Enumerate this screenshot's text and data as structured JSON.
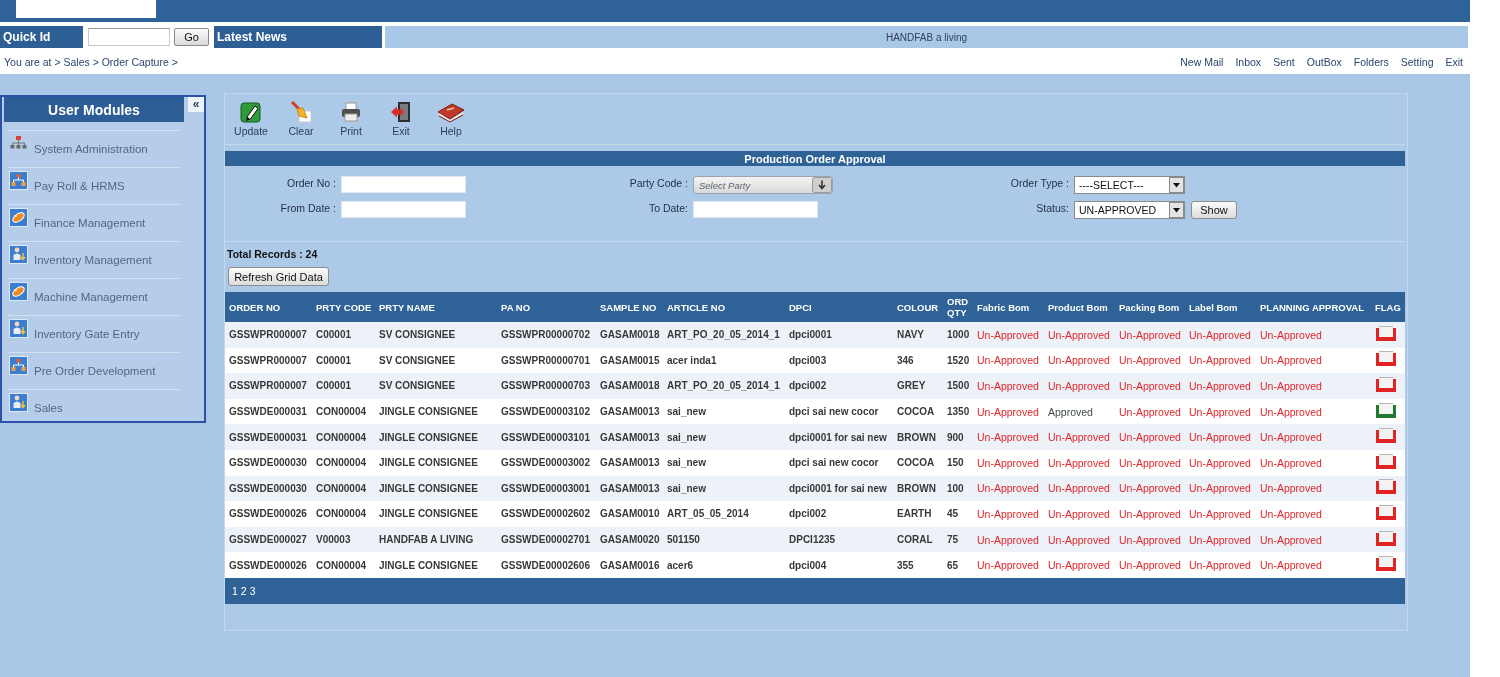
{
  "header": {
    "quick_id": {
      "label": "Quick Id",
      "button": "Go"
    },
    "news": {
      "label": "Latest News",
      "ticker": "HANDFAB a living"
    }
  },
  "breadcrumb": "You are at > Sales > Order Capture >",
  "top_links": [
    "New Mail",
    "Inbox",
    "Sent",
    "OutBox",
    "Folders",
    "Setting",
    "Exit"
  ],
  "sidebar": {
    "title": "User Modules",
    "collapse_button": "«",
    "items": [
      {
        "label": "System Administration",
        "kind": "hierarchy"
      },
      {
        "label": "Pay Roll & HRMS",
        "kind": "team"
      },
      {
        "label": "Finance Management",
        "kind": "pill"
      },
      {
        "label": "Inventory Management",
        "kind": "person"
      },
      {
        "label": "Machine Management",
        "kind": "pill"
      },
      {
        "label": "Inventory Gate Entry",
        "kind": "person"
      },
      {
        "label": "Pre Order Development",
        "kind": "team"
      },
      {
        "label": "Sales",
        "kind": "person"
      }
    ]
  },
  "toolbar": [
    {
      "label": "Update",
      "kind": "update"
    },
    {
      "label": "Clear",
      "kind": "clear"
    },
    {
      "label": "Print",
      "kind": "print"
    },
    {
      "label": "Exit",
      "kind": "exit"
    },
    {
      "label": "Help",
      "kind": "help"
    }
  ],
  "form": {
    "title": "Production Order Approval",
    "fields": [
      {
        "label": "Order No :",
        "kind": "text"
      },
      {
        "label": "Party Code :",
        "kind": "combo",
        "placeholder": "Select Party"
      },
      {
        "label": "Order Type :",
        "kind": "select",
        "value": "----SELECT---"
      },
      {
        "label": "From Date :",
        "kind": "date"
      },
      {
        "label": "To Date:",
        "kind": "date"
      },
      {
        "label": "Status:",
        "kind": "select",
        "value": "UN-APPROVED",
        "button": "Show"
      }
    ]
  },
  "total_records": "Total Records : 24",
  "refresh_button": "Refresh Grid Data",
  "table": {
    "columns": [
      "ORDER NO",
      "PRTY CODE",
      "PRTY NAME",
      "PA NO",
      "SAMPLE NO",
      "ARTICLE NO",
      "DPCI",
      "COLOUR",
      "ORD QTY",
      "Fabric Bom",
      "Product Bom",
      "Packing Bom",
      "Label Bom",
      "PLANNING APPROVAL",
      "FLAG"
    ],
    "rows": [
      {
        "cells": [
          "GSSWPR000007",
          "C00001",
          "SV CONSIGNEE",
          "GSSWPR00000702",
          "GASAM0018",
          "ART_PO_20_05_2014_1",
          "dpci0001",
          "NAVY",
          "1000"
        ],
        "approvals": [
          {
            "text": "Un-Approved",
            "approved": false
          },
          {
            "text": "Un-Approved",
            "approved": false
          },
          {
            "text": "Un-Approved",
            "approved": false
          },
          {
            "text": "Un-Approved",
            "approved": false
          },
          {
            "text": "Un-Approved",
            "approved": false
          }
        ],
        "flag": {
          "color": "#e02424"
        }
      },
      {
        "cells": [
          "GSSWPR000007",
          "C00001",
          "SV CONSIGNEE",
          "GSSWPR00000701",
          "GASAM0015",
          "acer inda1",
          "dpci003",
          "346",
          "1520"
        ],
        "approvals": [
          {
            "text": "Un-Approved",
            "approved": false
          },
          {
            "text": "Un-Approved",
            "approved": false
          },
          {
            "text": "Un-Approved",
            "approved": false
          },
          {
            "text": "Un-Approved",
            "approved": false
          },
          {
            "text": "Un-Approved",
            "approved": false
          }
        ],
        "flag": {
          "color": "#e02424"
        }
      },
      {
        "cells": [
          "GSSWPR000007",
          "C00001",
          "SV CONSIGNEE",
          "GSSWPR00000703",
          "GASAM0018",
          "ART_PO_20_05_2014_1",
          "dpci002",
          "GREY",
          "1500"
        ],
        "approvals": [
          {
            "text": "Un-Approved",
            "approved": false
          },
          {
            "text": "Un-Approved",
            "approved": false
          },
          {
            "text": "Un-Approved",
            "approved": false
          },
          {
            "text": "Un-Approved",
            "approved": false
          },
          {
            "text": "Un-Approved",
            "approved": false
          }
        ],
        "flag": {
          "color": "#e02424"
        }
      },
      {
        "cells": [
          "GSSWDE000031",
          "CON00004",
          "JINGLE CONSIGNEE",
          "GSSWDE00003102",
          "GASAM0013",
          "sai_new",
          "dpci sai new cocor",
          "COCOA",
          "1350"
        ],
        "approvals": [
          {
            "text": "Un-Approved",
            "approved": false
          },
          {
            "text": "Approved",
            "approved": true
          },
          {
            "text": "Un-Approved",
            "approved": false
          },
          {
            "text": "Un-Approved",
            "approved": false
          },
          {
            "text": "Un-Approved",
            "approved": false
          }
        ],
        "flag": {
          "color": "#1f7a30"
        }
      },
      {
        "cells": [
          "GSSWDE000031",
          "CON00004",
          "JINGLE CONSIGNEE",
          "GSSWDE00003101",
          "GASAM0013",
          "sai_new",
          "dpci0001 for sai new",
          "BROWN",
          "900"
        ],
        "approvals": [
          {
            "text": "Un-Approved",
            "approved": false
          },
          {
            "text": "Un-Approved",
            "approved": false
          },
          {
            "text": "Un-Approved",
            "approved": false
          },
          {
            "text": "Un-Approved",
            "approved": false
          },
          {
            "text": "Un-Approved",
            "approved": false
          }
        ],
        "flag": {
          "color": "#e02424"
        }
      },
      {
        "cells": [
          "GSSWDE000030",
          "CON00004",
          "JINGLE CONSIGNEE",
          "GSSWDE00003002",
          "GASAM0013",
          "sai_new",
          "dpci sai new cocor",
          "COCOA",
          "150"
        ],
        "approvals": [
          {
            "text": "Un-Approved",
            "approved": false
          },
          {
            "text": "Un-Approved",
            "approved": false
          },
          {
            "text": "Un-Approved",
            "approved": false
          },
          {
            "text": "Un-Approved",
            "approved": false
          },
          {
            "text": "Un-Approved",
            "approved": false
          }
        ],
        "flag": {
          "color": "#e02424"
        }
      },
      {
        "cells": [
          "GSSWDE000030",
          "CON00004",
          "JINGLE CONSIGNEE",
          "GSSWDE00003001",
          "GASAM0013",
          "sai_new",
          "dpci0001 for sai new",
          "BROWN",
          "100"
        ],
        "approvals": [
          {
            "text": "Un-Approved",
            "approved": false
          },
          {
            "text": "Un-Approved",
            "approved": false
          },
          {
            "text": "Un-Approved",
            "approved": false
          },
          {
            "text": "Un-Approved",
            "approved": false
          },
          {
            "text": "Un-Approved",
            "approved": false
          }
        ],
        "flag": {
          "color": "#e02424"
        }
      },
      {
        "cells": [
          "GSSWDE000026",
          "CON00004",
          "JINGLE CONSIGNEE",
          "GSSWDE00002602",
          "GASAM0010",
          "ART_05_05_2014",
          "dpci002",
          "EARTH",
          "45"
        ],
        "approvals": [
          {
            "text": "Un-Approved",
            "approved": false
          },
          {
            "text": "Un-Approved",
            "approved": false
          },
          {
            "text": "Un-Approved",
            "approved": false
          },
          {
            "text": "Un-Approved",
            "approved": false
          },
          {
            "text": "Un-Approved",
            "approved": false
          }
        ],
        "flag": {
          "color": "#e02424"
        }
      },
      {
        "cells": [
          "GSSWDE000027",
          "V00003",
          "HANDFAB A LIVING",
          "GSSWDE00002701",
          "GASAM0020",
          "501150",
          "DPCI1235",
          "CORAL",
          "75"
        ],
        "approvals": [
          {
            "text": "Un-Approved",
            "approved": false
          },
          {
            "text": "Un-Approved",
            "approved": false
          },
          {
            "text": "Un-Approved",
            "approved": false
          },
          {
            "text": "Un-Approved",
            "approved": false
          },
          {
            "text": "Un-Approved",
            "approved": false
          }
        ],
        "flag": {
          "color": "#e02424"
        }
      },
      {
        "cells": [
          "GSSWDE000026",
          "CON00004",
          "JINGLE CONSIGNEE",
          "GSSWDE00002606",
          "GASAM0016",
          "acer6",
          "dpci004",
          "355",
          "65"
        ],
        "approvals": [
          {
            "text": "Un-Approved",
            "approved": false
          },
          {
            "text": "Un-Approved",
            "approved": false
          },
          {
            "text": "Un-Approved",
            "approved": false
          },
          {
            "text": "Un-Approved",
            "approved": false
          },
          {
            "text": "Un-Approved",
            "approved": false
          }
        ],
        "flag": {
          "color": "#e02424"
        }
      }
    ],
    "pages": [
      "1",
      "2",
      "3"
    ]
  }
}
